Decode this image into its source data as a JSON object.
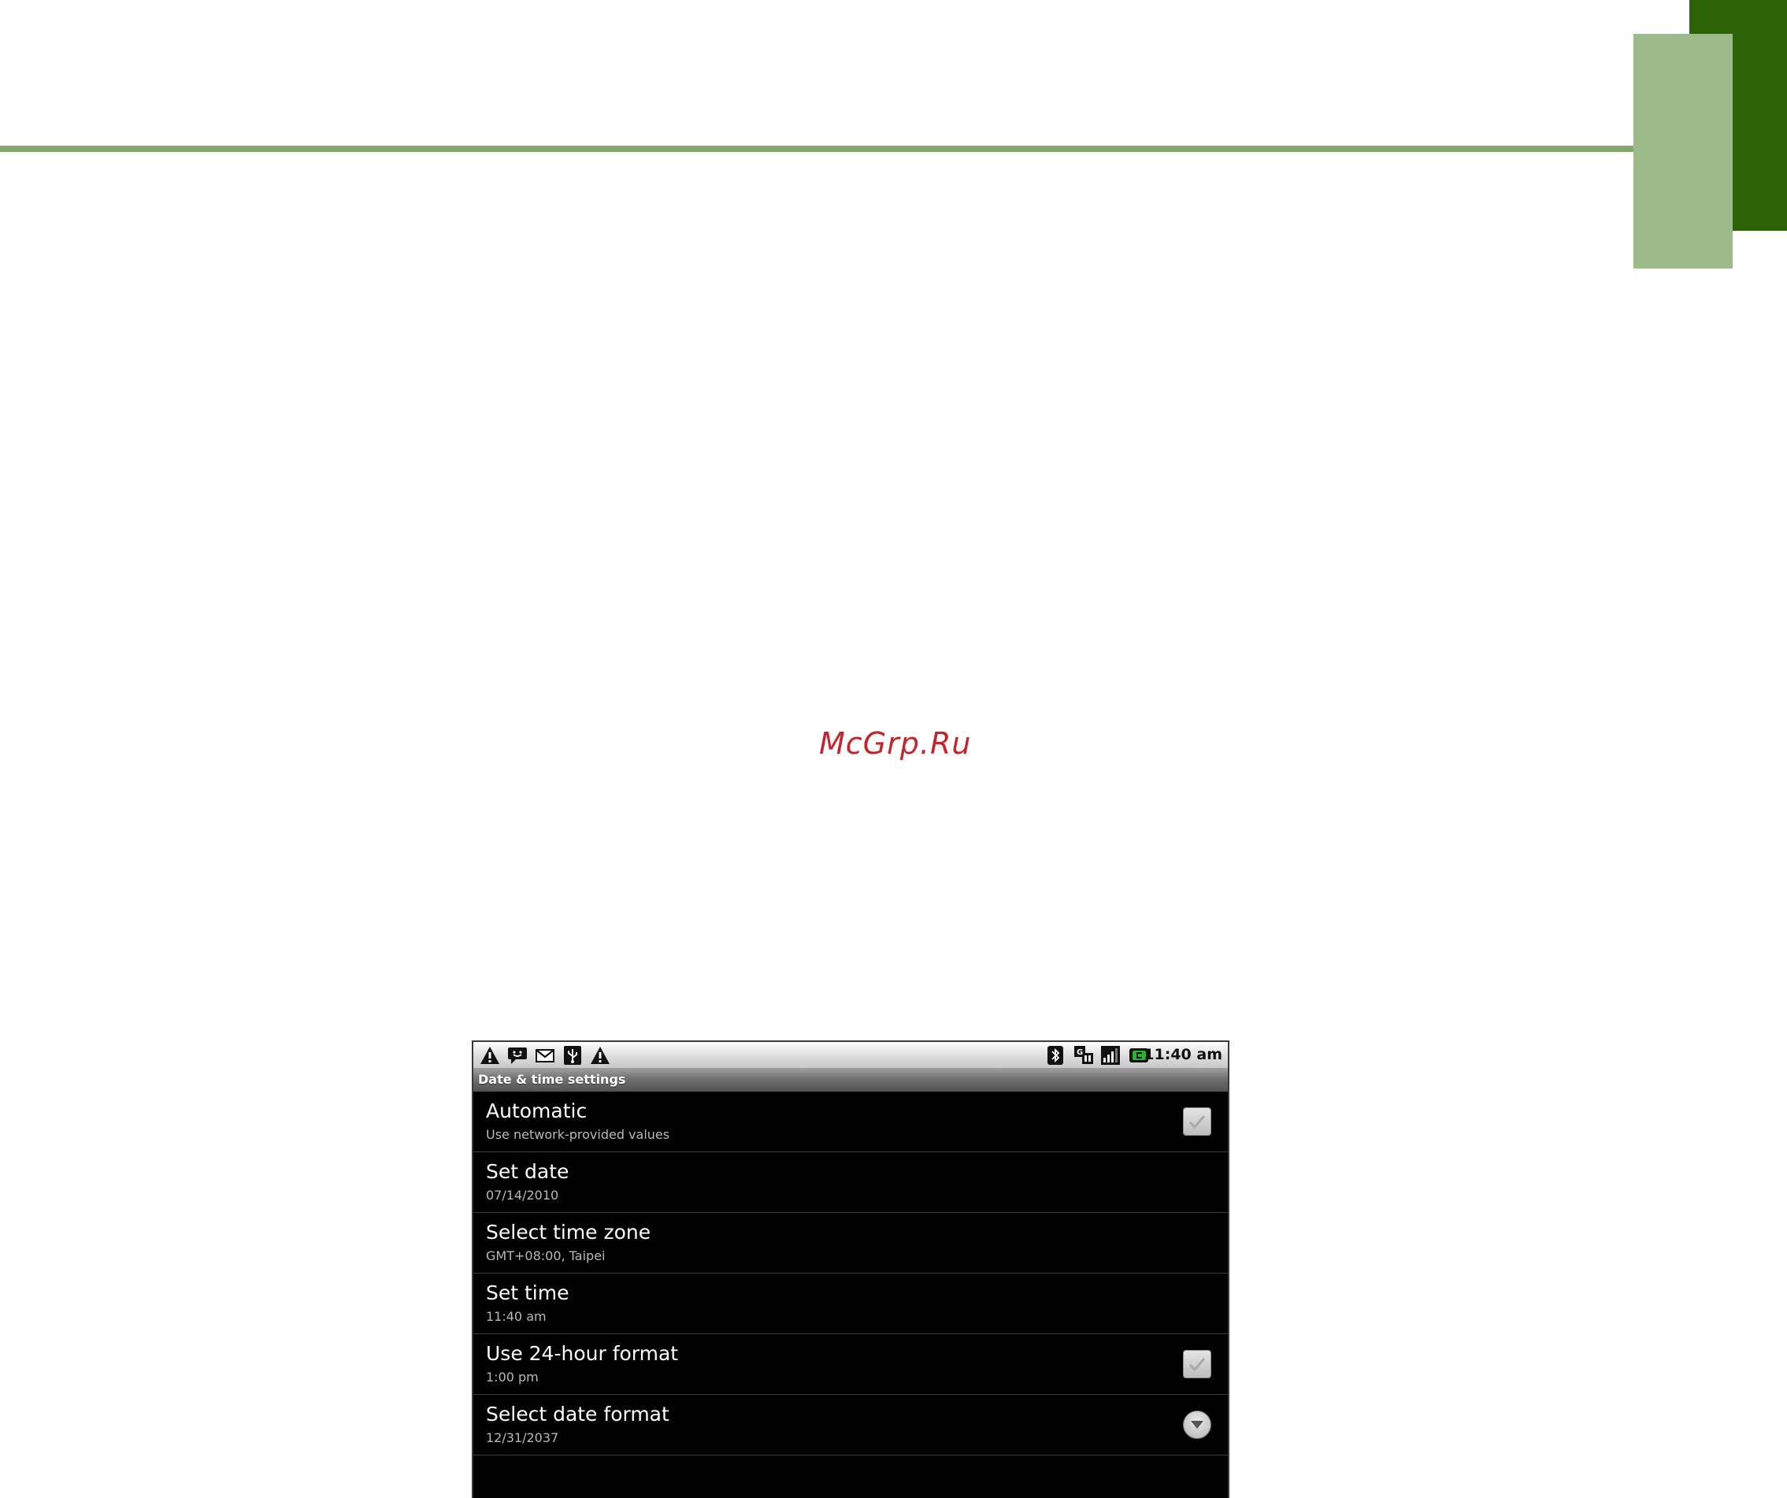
{
  "watermark": "McGrp.Ru",
  "device": {
    "status_bar": {
      "left_icons": [
        "warning-icon",
        "chat-icon",
        "gmail-icon",
        "usb-icon",
        "warning-icon"
      ],
      "right_icons": [
        "bluetooth-icon",
        "data-sync-icon",
        "signal-icon",
        "battery-icon"
      ],
      "clock": "11:40 am"
    },
    "title": "Date & time settings",
    "settings": [
      {
        "title": "Automatic",
        "summary": "Use network-provided values",
        "control": "checkbox",
        "checked": true
      },
      {
        "title": "Set date",
        "summary": "07/14/2010",
        "control": "none"
      },
      {
        "title": "Select time zone",
        "summary": "GMT+08:00, Taipei",
        "control": "none"
      },
      {
        "title": "Set time",
        "summary": "11:40 am",
        "control": "none"
      },
      {
        "title": "Use 24-hour format",
        "summary": "1:00 pm",
        "control": "checkbox",
        "checked": true
      },
      {
        "title": "Select date format",
        "summary": "12/31/2037",
        "control": "dropdown"
      }
    ]
  },
  "colors": {
    "accent_rule": "#84a86c",
    "corner_dark": "#2b6306",
    "corner_light": "#9dbb8a",
    "watermark": "#c0272d"
  }
}
